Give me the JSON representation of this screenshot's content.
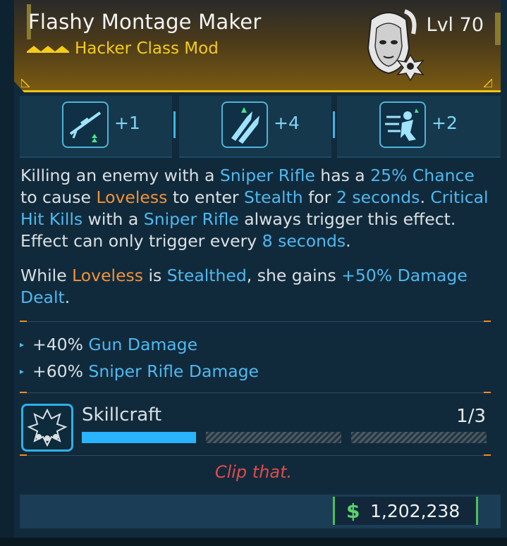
{
  "item": {
    "name": "Flashy Montage Maker",
    "type": "Hacker Class Mod",
    "level": "Lvl 70",
    "rarity_color": "#f5cc1a"
  },
  "stats": [
    {
      "icon": "sniper-rifle-icon",
      "value": "+1"
    },
    {
      "icon": "rockets-icon",
      "value": "+4"
    },
    {
      "icon": "dash-attack-icon",
      "value": "+2"
    }
  ],
  "description": {
    "p1": {
      "t1": "Killing an enemy with a ",
      "k1": "Sniper Rifle",
      "t2": " has a ",
      "k2": "25% Chance",
      "t3": " to cause ",
      "k3": "Loveless",
      "t4": " to enter ",
      "k4": "Stealth",
      "t5": " for ",
      "k5": "2 seconds",
      "t6": ". ",
      "k6": "Critical Hit Kills",
      "t7": " with a ",
      "k7": "Sniper Rifle",
      "t8": " always trigger this effect. Effect can only trigger every ",
      "k8": "8 seconds",
      "t9": "."
    },
    "p2": {
      "t1": "While ",
      "k1": "Loveless",
      "t2": " is ",
      "k2": "Stealthed",
      "t3": ", she gains ",
      "k3": "+50% Damage Dealt",
      "t4": "."
    }
  },
  "bonuses": [
    {
      "amount": "+40%",
      "stat": "Gun Damage"
    },
    {
      "amount": "+60%",
      "stat": "Sniper Rifle Damage"
    }
  ],
  "skillcraft": {
    "label": "Skillcraft",
    "count": "1/3",
    "progress": 0.333
  },
  "flavor_text": "Clip that.",
  "price": {
    "symbol": "$",
    "value": "1,202,238"
  }
}
